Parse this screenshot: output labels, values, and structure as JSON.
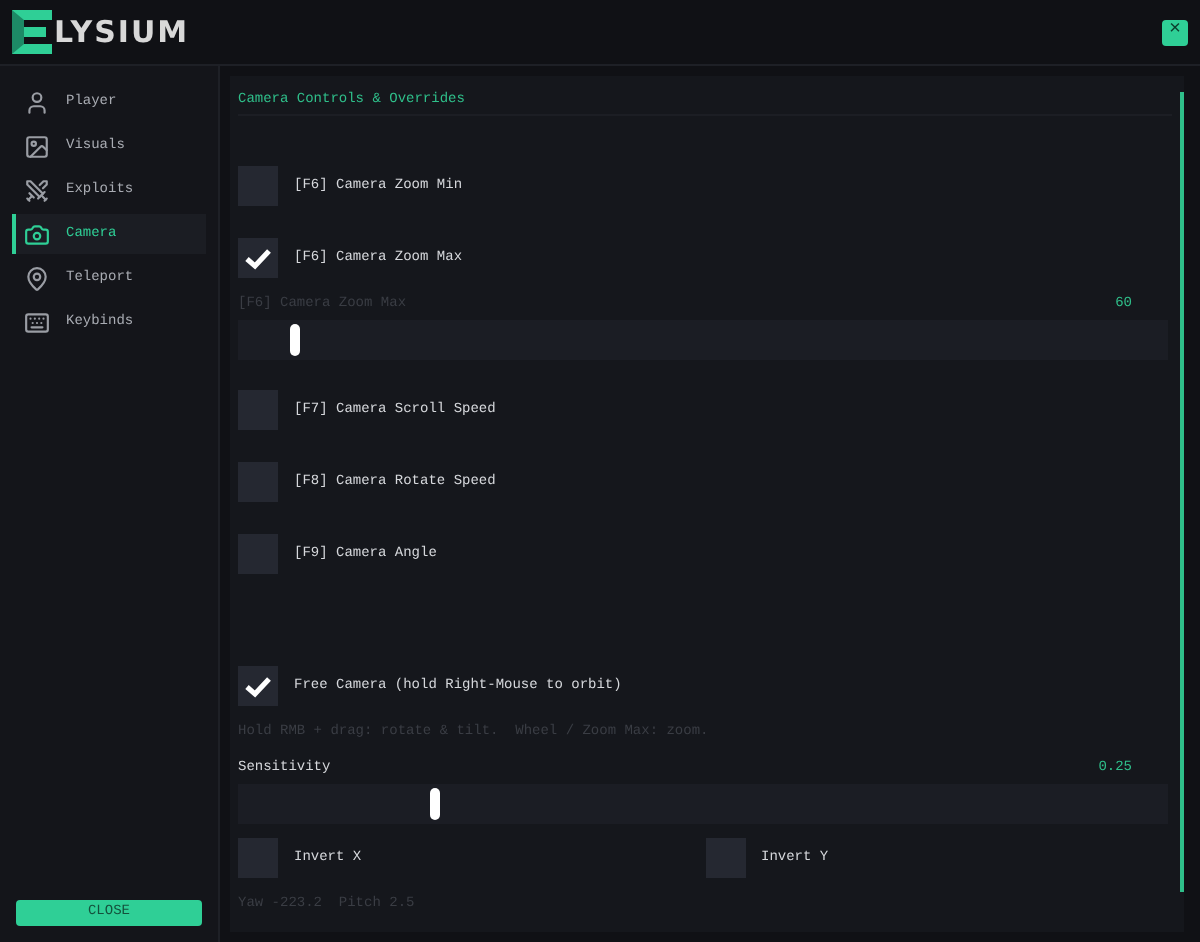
{
  "header": {
    "logo_text": "LYSIUM",
    "close_glyph": "×"
  },
  "sidebar": {
    "items": [
      {
        "label": "Player",
        "selected": false
      },
      {
        "label": "Visuals",
        "selected": false
      },
      {
        "label": "Exploits",
        "selected": false
      },
      {
        "label": "Camera",
        "selected": true
      },
      {
        "label": "Teleport",
        "selected": false
      },
      {
        "label": "Keybinds",
        "selected": false
      }
    ],
    "close_button": "CLOSE"
  },
  "panel": {
    "title": "Camera Controls & Overrides",
    "items": [
      {
        "kind": "checkbox",
        "label": "[F6] Camera Zoom Min",
        "checked": false
      },
      {
        "kind": "checkbox",
        "label": "[F6] Camera Zoom Max",
        "checked": true
      },
      {
        "kind": "slider",
        "label": "[F6] Camera Zoom Max",
        "reading": "60",
        "level": 0.06,
        "disabled": true
      },
      {
        "kind": "checkbox",
        "label": "[F7] Camera Scroll Speed",
        "checked": false
      },
      {
        "kind": "checkbox",
        "label": "[F8] Camera Rotate Speed",
        "checked": false
      },
      {
        "kind": "checkbox",
        "label": "[F9] Camera Angle",
        "checked": false
      },
      {
        "kind": "spacer"
      },
      {
        "kind": "checkbox",
        "label": "Free Camera (hold Right-Mouse to orbit)",
        "checked": true
      },
      {
        "kind": "hint",
        "label": "Hold RMB + drag: rotate & tilt.  Wheel / Zoom Max: zoom."
      },
      {
        "kind": "slider",
        "label": "Sensitivity",
        "reading": "0.25",
        "level": 0.21,
        "disabled": false
      },
      {
        "kind": "pair",
        "items": [
          {
            "label": "Invert X",
            "checked": false
          },
          {
            "label": "Invert Y",
            "checked": false
          }
        ]
      },
      {
        "kind": "hint",
        "label": "Yaw -223.2  Pitch 2.5"
      }
    ]
  }
}
